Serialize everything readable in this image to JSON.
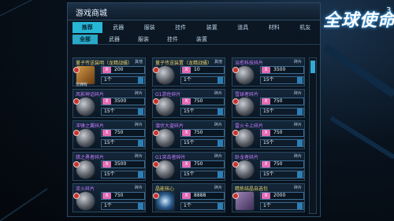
{
  "window": {
    "title": "游戏商城"
  },
  "tabs": [
    {
      "label": "推荐",
      "active": true
    },
    {
      "label": "武器",
      "active": false
    },
    {
      "label": "服装",
      "active": false
    },
    {
      "label": "挂件",
      "active": false
    },
    {
      "label": "装置",
      "active": false
    },
    {
      "label": "道具",
      "active": false
    },
    {
      "label": "材料",
      "active": false
    },
    {
      "label": "机友",
      "active": false
    }
  ],
  "subtabs": [
    {
      "label": "全部",
      "active": true
    },
    {
      "label": "武器",
      "active": false
    },
    {
      "label": "服装",
      "active": false
    },
    {
      "label": "挂件",
      "active": false
    },
    {
      "label": "装置",
      "active": false
    }
  ],
  "logo": {
    "text": "全球使命",
    "sup": "3"
  },
  "currency_symbol": "X",
  "items": [
    {
      "name": "量子传送装明（龙精战骚）",
      "tag": "其他",
      "price": "200",
      "qty": "1个",
      "note": "仅拥有",
      "name_color": "gold",
      "thumb": "gold"
    },
    {
      "name": "量子传送装置（龙精战骚）",
      "tag": "其他",
      "price": "10",
      "qty": "1个",
      "note": "",
      "name_color": "gold",
      "thumb": "mech"
    },
    {
      "name": "治愈科技碎片",
      "tag": "碎片",
      "price": "3500",
      "qty": "15个",
      "note": "",
      "name_color": "purple",
      "thumb": "mech"
    },
    {
      "name": "风影神话碎片",
      "tag": "碎片",
      "price": "3500",
      "qty": "15个",
      "note": "",
      "name_color": "purple",
      "thumb": "mech"
    },
    {
      "name": "G1游佐碎片",
      "tag": "碎片",
      "price": "750",
      "qty": "15个",
      "note": "",
      "name_color": "purple",
      "thumb": "mech"
    },
    {
      "name": "雪球者碎片",
      "tag": "碎片",
      "price": "750",
      "qty": "15个",
      "note": "",
      "name_color": "purple",
      "thumb": "mech"
    },
    {
      "name": "冲锋之翼碎片",
      "tag": "碎片",
      "price": "750",
      "qty": "15个",
      "note": "",
      "name_color": "purple",
      "thumb": "mech"
    },
    {
      "name": "潜伏大盗碎片",
      "tag": "碎片",
      "price": "750",
      "qty": "15个",
      "note": "",
      "name_color": "purple",
      "thumb": "mech"
    },
    {
      "name": "雷火卡上碎片",
      "tag": "碎片",
      "price": "750",
      "qty": "15个",
      "note": "",
      "name_color": "purple",
      "thumb": "mech"
    },
    {
      "name": "猎之勇者碎片",
      "tag": "碎片",
      "price": "3500",
      "qty": "15个",
      "note": "",
      "name_color": "purple",
      "thumb": "mech"
    },
    {
      "name": "G1突击者碎片",
      "tag": "碎片",
      "price": "750",
      "qty": "15个",
      "note": "",
      "name_color": "purple",
      "thumb": "mech"
    },
    {
      "name": "卧龙者碎片",
      "tag": "碎片",
      "price": "750",
      "qty": "15个",
      "note": "",
      "name_color": "purple",
      "thumb": "mech"
    },
    {
      "name": "流火碎片",
      "tag": "碎片",
      "price": "750",
      "qty": "1个",
      "note": "",
      "name_color": "purple",
      "thumb": "mech"
    },
    {
      "name": "晶能核心",
      "tag": "碎片",
      "price": "8888",
      "qty": "1个",
      "note": "",
      "name_color": "gold",
      "thumb": "core"
    },
    {
      "name": "精炼结晶自选包",
      "tag": "碎片",
      "price": "2000",
      "qty": "1个",
      "note": "",
      "name_color": "gold",
      "thumb": "box"
    }
  ]
}
